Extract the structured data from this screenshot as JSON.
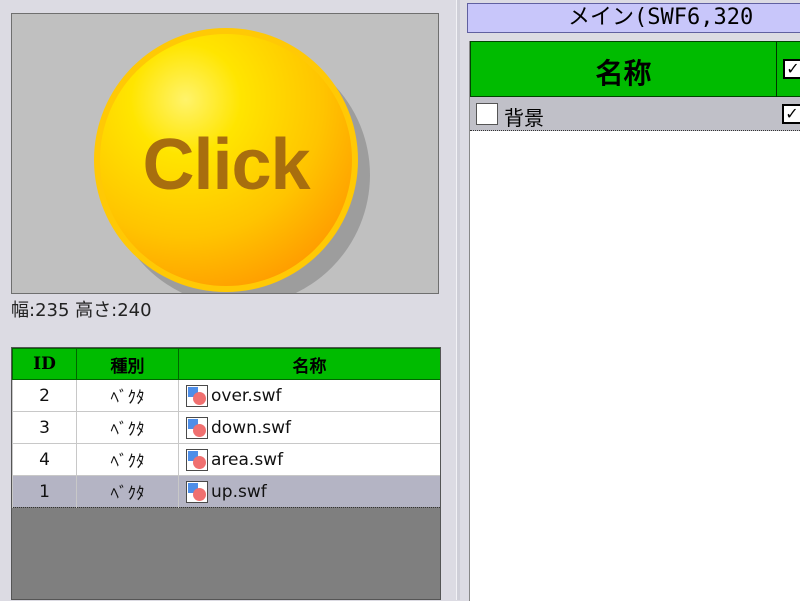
{
  "preview": {
    "button_text": "Click",
    "size_info": "幅:235 高さ:240"
  },
  "asset_table": {
    "columns": [
      "ID",
      "種別",
      "名称"
    ],
    "rows": [
      {
        "id": "2",
        "type": "ﾍﾞｸﾀ",
        "name": "over.swf",
        "selected": false
      },
      {
        "id": "3",
        "type": "ﾍﾞｸﾀ",
        "name": "down.swf",
        "selected": false
      },
      {
        "id": "4",
        "type": "ﾍﾞｸﾀ",
        "name": "area.swf",
        "selected": false
      },
      {
        "id": "1",
        "type": "ﾍﾞｸﾀ",
        "name": "up.swf",
        "selected": true
      }
    ]
  },
  "scene": {
    "title": "メイン(SWF6,320"
  },
  "layers": {
    "header_name": "名称",
    "header_checked": true,
    "rows": [
      {
        "label": "背景",
        "checked": false,
        "visible_checked": true
      }
    ]
  },
  "colors": {
    "header_green": "#00bb00",
    "button_yellow": "#ffd700",
    "button_orange": "#ff8800",
    "button_text": "#a86e0e",
    "title_bar": "#c8c6fa",
    "selected_row": "#b4b4c4"
  },
  "icons": {
    "file": "swf-file-icon",
    "check": "checkmark-icon"
  }
}
